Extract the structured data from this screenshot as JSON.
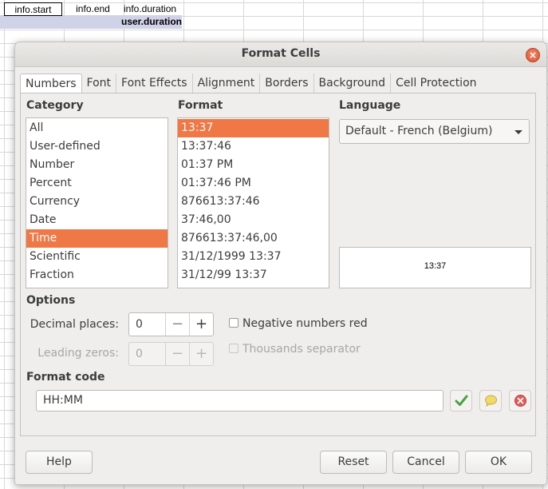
{
  "spreadsheet": {
    "row1": [
      "",
      "",
      ""
    ],
    "row2": [
      "info.start",
      "info.end",
      "info.duration"
    ],
    "row3": [
      "",
      "",
      "user.duration"
    ]
  },
  "dialog": {
    "title": "Format Cells",
    "tabs": [
      "Numbers",
      "Font",
      "Font Effects",
      "Alignment",
      "Borders",
      "Background",
      "Cell Protection"
    ],
    "active_tab": "Numbers",
    "category": {
      "label": "Category",
      "items": [
        "All",
        "User-defined",
        "Number",
        "Percent",
        "Currency",
        "Date",
        "Time",
        "Scientific",
        "Fraction"
      ],
      "selected": "Time"
    },
    "format": {
      "label": "Format",
      "items": [
        "13:37",
        "13:37:46",
        "01:37 PM",
        "01:37:46 PM",
        "876613:37:46",
        "37:46,00",
        "876613:37:46,00",
        "31/12/1999 13:37",
        "31/12/99 13:37"
      ],
      "selected": "13:37"
    },
    "language": {
      "label": "Language",
      "value": "Default - French (Belgium)"
    },
    "preview": "13:37",
    "options": {
      "label": "Options",
      "decimal_places_label": "Decimal places:",
      "decimal_places_value": "0",
      "leading_zeros_label": "Leading zeros:",
      "leading_zeros_value": "0",
      "negative_red_label": "Negative numbers red",
      "thousands_sep_label": "Thousands separator",
      "minus": "−",
      "plus": "+"
    },
    "format_code": {
      "label": "Format code",
      "value": "HH:MM"
    },
    "buttons": {
      "help": "Help",
      "reset": "Reset",
      "cancel": "Cancel",
      "ok": "OK",
      "close": "×"
    },
    "colors": {
      "selection": "#f07746",
      "accept_icon": "#4aa33f",
      "comment_icon": "#f2d96b",
      "delete_icon": "#e35b5b"
    },
    "icons": {
      "accept": "checkmark-icon",
      "comment": "speech-bubble-icon",
      "delete": "delete-circle-icon"
    }
  }
}
